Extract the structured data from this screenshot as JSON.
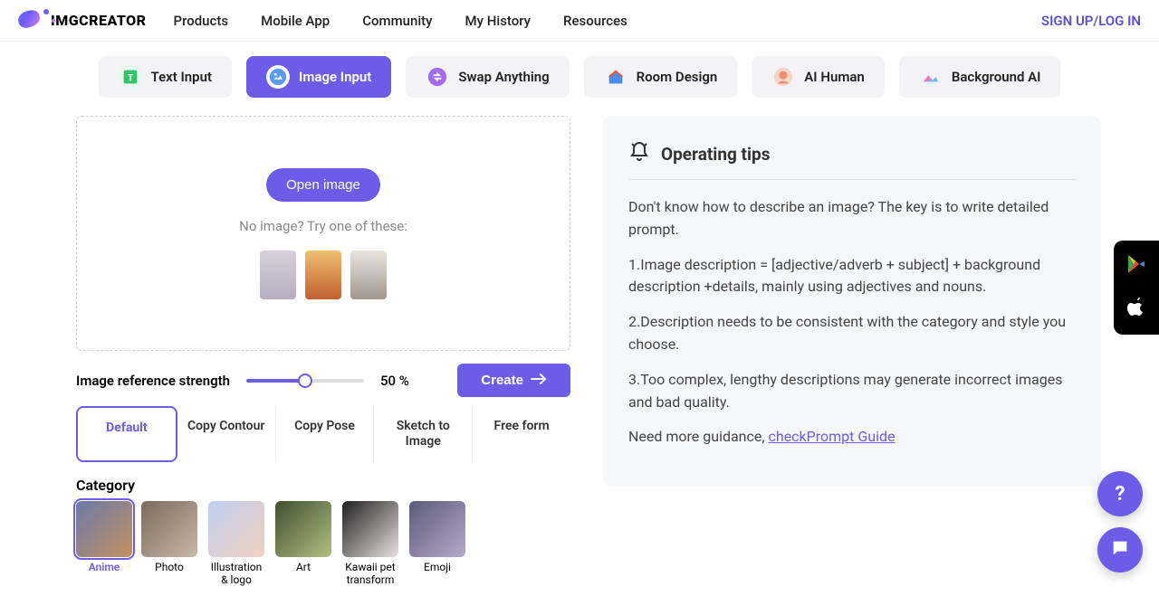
{
  "header": {
    "brand": "IMGCREATOR",
    "nav": [
      "Products",
      "Mobile App",
      "Community",
      "My History",
      "Resources"
    ],
    "auth": "SIGN UP/LOG IN"
  },
  "modes": {
    "items": [
      {
        "label": "Text Input"
      },
      {
        "label": "Image Input"
      },
      {
        "label": "Swap Anything"
      },
      {
        "label": "Room Design"
      },
      {
        "label": "AI Human"
      },
      {
        "label": "Background AI"
      }
    ],
    "active_index": 1
  },
  "upload": {
    "open_label": "Open image",
    "try_label": "No image? Try one of these:"
  },
  "strength": {
    "label": "Image reference strength",
    "percent_label": "50 %",
    "percent_value": 50,
    "create_label": "Create"
  },
  "subtabs": {
    "items": [
      "Default",
      "Copy Contour",
      "Copy Pose",
      "Sketch to Image",
      "Free form"
    ],
    "active_index": 0
  },
  "category": {
    "title": "Category",
    "items": [
      "Anime",
      "Photo",
      "Illustration & logo",
      "Art",
      "Kawaii pet transform",
      "Emoji"
    ],
    "active_index": 0
  },
  "tips": {
    "title": "Operating tips",
    "intro": "Don't know how to describe an image? The key is to write detailed prompt.",
    "p1": "1.Image description = [adjective/adverb + subject] + background description +details, mainly using adjectives and nouns.",
    "p2": "2.Description needs to be consistent with the category and style you choose.",
    "p3": "3.Too complex, lengthy descriptions may generate incorrect images and bad quality.",
    "guide_prefix": "Need more guidance, ",
    "guide_link": "checkPrompt Guide"
  },
  "fab": {
    "help": "?"
  }
}
